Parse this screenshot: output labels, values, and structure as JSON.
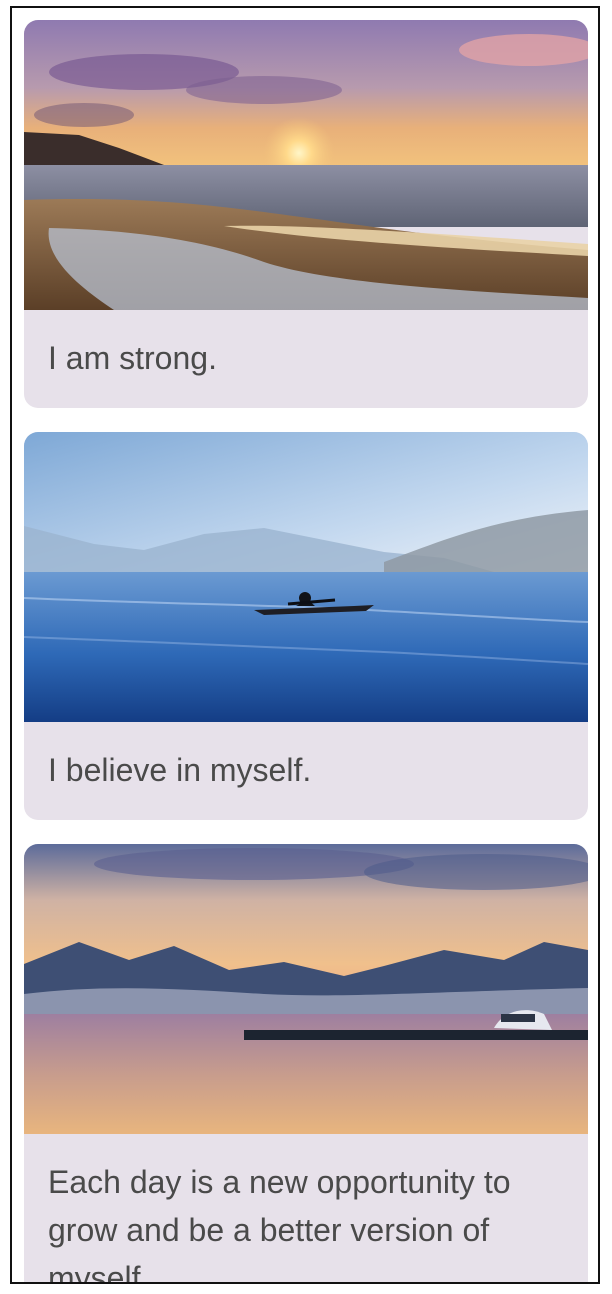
{
  "cards": [
    {
      "image": "sunset-beach-photo",
      "text": "I am strong."
    },
    {
      "image": "kayak-on-misty-lake-photo",
      "text": "I believe in myself."
    },
    {
      "image": "mountain-lake-dusk-photo",
      "text": "Each day is a new opportunity to grow and be a better version of myself."
    }
  ]
}
